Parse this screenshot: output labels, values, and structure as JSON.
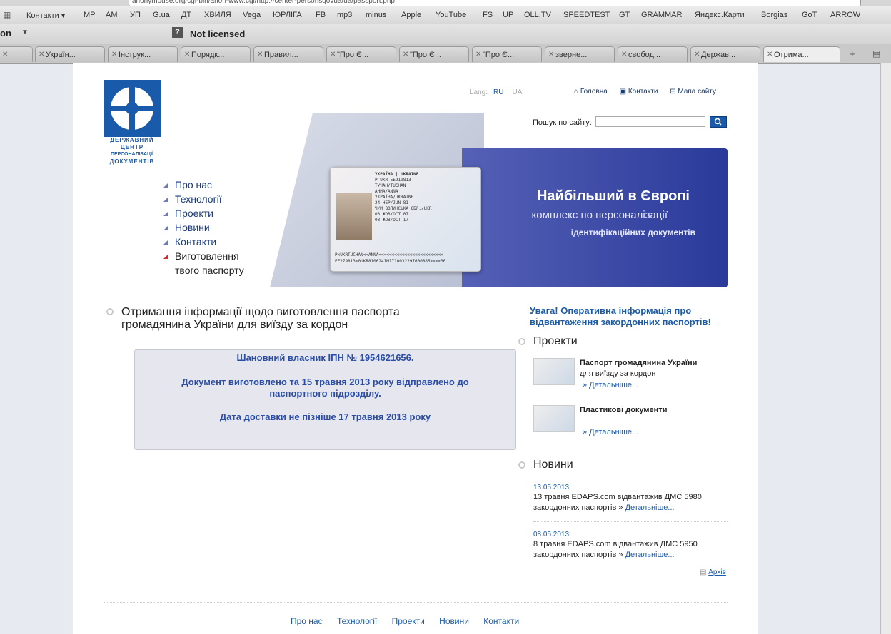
{
  "browser": {
    "url": "anonymouse.org/cgi-bin/anon-www.cgi/http://center-personsgovua/ua/passport.php",
    "bookmarks": [
      "Контакти ▾",
      "MP",
      "AM",
      "УП",
      "G.ua",
      "ДТ",
      "ХВИЛЯ",
      "Vega",
      "ЮРЛІГА",
      "FB",
      "mp3",
      "minus",
      "Apple",
      "YouTube",
      "FS",
      "UP",
      "OLL.TV",
      "SPEEDTEST",
      "GT",
      "GRAMMAR",
      "Яндекс.Карти",
      "Borgias",
      "GoT",
      "ARROW"
    ],
    "extension_left": "on",
    "not_licensed": "Not licensed",
    "tabs": [
      "с",
      "Україн...",
      "Інструк...",
      "Порядк...",
      "Правил...",
      "\"Про Є...",
      "\"Про Є...",
      "\"Про Є...",
      "зверне...",
      "свобод...",
      "Держав...",
      "Отрима..."
    ]
  },
  "header": {
    "logo_lines": [
      "Державний",
      "центр",
      "персоналізації",
      "документів"
    ],
    "lang_label": "Lang:",
    "lang_ru": "RU",
    "lang_ua": "UA",
    "top_links": [
      "Головна",
      "Контакти",
      "Мапа сайту"
    ],
    "search_label": "Пошук по сайту:",
    "search_placeholder": ""
  },
  "hero": {
    "line1": "Найбільший в Європі",
    "line2": "комплекс по персоналізації",
    "line3": "ідентифікаційних документів",
    "card_text": [
      "УКРАЇНА | UKRAINE",
      "P      UKR         EE919813",
      "ТУЧАН/TUCHAN",
      "АННА/ANNA",
      "УКРАЇНА/UKRAINE",
      "24 ЧЕР/JUN 81",
      "Ч/M   ВОЛИНСЬКА ОБЛ./UKR",
      "03 ЖОВ/OCT 07",
      "03 ЖОВ/OCT 17"
    ],
    "card_mrz": [
      "P<UKRTUCHAN<<ANNA<<<<<<<<<<<<<<<<<<<<<<<<<",
      "EE279813<0UKR8106241M1710032297600885<<<<36"
    ]
  },
  "left_nav": [
    "Про нас",
    "Технології",
    "Проекти",
    "Новини",
    "Контакти",
    "Виготовлення",
    "твого паспорту"
  ],
  "main": {
    "title_line1": "Отримання інформації щодо виготовлення паспорта",
    "title_line2": "громадянина України для виїзду за кордон",
    "box_line1": "Шановний власник ІПН № 1954621656.",
    "box_line2": "Документ виготовлено та 15 травня 2013 року відправлено до",
    "box_line3": "паспортного підрозділу.",
    "box_line4": "Дата доставки не пізніше 17 травня 2013 року"
  },
  "sidebar": {
    "warning": "Увага! Оперативна інформація про відвантаження закордонних паспортів!",
    "projects_heading": "Проекти",
    "projects": [
      {
        "title": "Паспорт громадянина України",
        "sub": "для виїзду за кордон",
        "more": "» Детальніше..."
      },
      {
        "title": "Пластикові документи",
        "sub": "",
        "more": "» Детальніше..."
      }
    ],
    "news_heading": "Новини",
    "news": [
      {
        "date": "13.05.2013",
        "text": "13 травня EDAPS.com відвантажив ДМС 5980 закордонних паспортів »",
        "more": "Детальніше..."
      },
      {
        "date": "08.05.2013",
        "text": "8 травня EDAPS.com відвантажив ДМС 5950 закордонних паспортів »",
        "more": "Детальніше..."
      }
    ],
    "archive": "Архів"
  },
  "footer": {
    "links": [
      "Про нас",
      "Технології",
      "Проекти",
      "Новини",
      "Контакти"
    ]
  },
  "colors": {
    "brand_blue": "#1a5aab",
    "hero_blue": "#3b4aa8",
    "box_bg": "#e6e7ee"
  }
}
